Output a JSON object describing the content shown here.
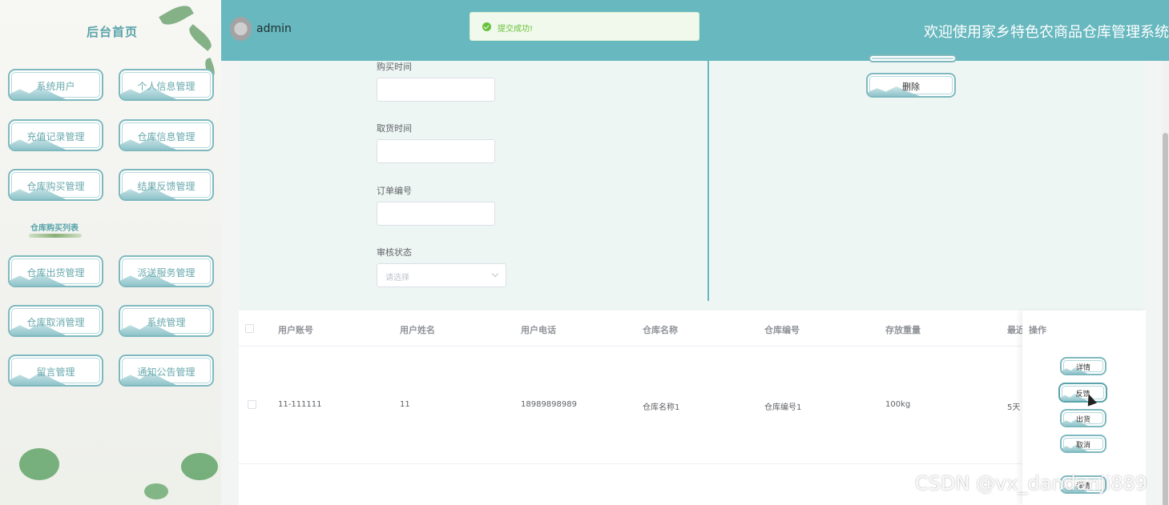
{
  "sidebar": {
    "title": "后台首页",
    "items": [
      {
        "label": "系统用户"
      },
      {
        "label": "个人信息管理"
      },
      {
        "label": "充值记录管理"
      },
      {
        "label": "仓库信息管理"
      },
      {
        "label": "仓库购买管理"
      },
      {
        "label": "结果反馈管理"
      },
      {
        "label": "仓库出货管理"
      },
      {
        "label": "派送服务管理"
      },
      {
        "label": "仓库取消管理"
      },
      {
        "label": "系统管理"
      },
      {
        "label": "留言管理"
      },
      {
        "label": "通知公告管理"
      }
    ],
    "section_label": "仓库购买列表"
  },
  "header": {
    "username": "admin",
    "welcome": "欢迎使用家乡特色农商品仓库管理系统"
  },
  "toast": {
    "message": "提交成功!"
  },
  "form": {
    "fields": [
      {
        "label": "购买时间",
        "value": ""
      },
      {
        "label": "取货时间",
        "value": ""
      },
      {
        "label": "订单编号",
        "value": ""
      }
    ],
    "status": {
      "label": "审核状态",
      "placeholder": "请选择"
    },
    "delete_label": "删除"
  },
  "table": {
    "headers": [
      "用户账号",
      "用户姓名",
      "用户电话",
      "仓库名称",
      "仓库编号",
      "存放重量",
      "最近",
      "操作"
    ],
    "rows": [
      {
        "cells": [
          "11-111111",
          "11",
          "18989898989",
          "仓库名称1",
          "仓库编号1",
          "100kg",
          "5天"
        ]
      }
    ],
    "actions": [
      "详情",
      "反馈",
      "出货",
      "取消"
    ],
    "next_row_action": "详情"
  },
  "watermark": "CSDN @vx_dandanji889",
  "colors": {
    "accent": "#67b8bf",
    "success": "#67c23a"
  }
}
